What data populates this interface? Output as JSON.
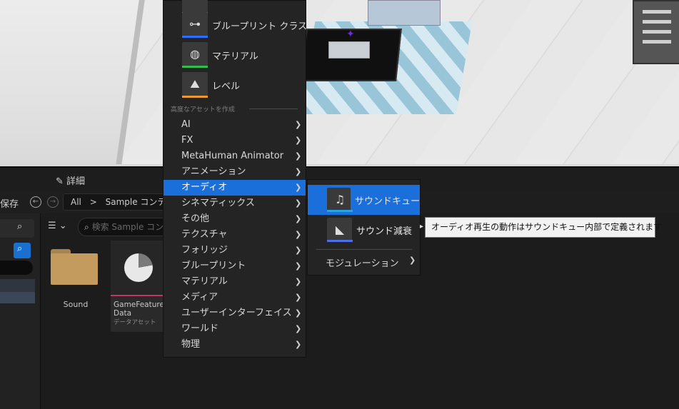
{
  "tabs": {
    "details": "詳細"
  },
  "toolbar": {
    "save": "保存",
    "back": "←",
    "forward": "→"
  },
  "breadcrumb": {
    "root": "All",
    "separator": ">",
    "current": "Sample コンテ"
  },
  "search": {
    "placeholder": "検索 Sample コン"
  },
  "assets": [
    {
      "name": "Sound",
      "type": ""
    },
    {
      "name": "GameFeature Data",
      "type": "データアセット"
    }
  ],
  "context_menu": {
    "basic_assets": [
      {
        "label": "ブループリント クラス",
        "icon": "blueprint-icon",
        "color": "#2f6fff"
      },
      {
        "label": "マテリアル",
        "icon": "material-icon",
        "color": "#2fbf4f"
      },
      {
        "label": "レベル",
        "icon": "level-icon",
        "color": "#e89a2c"
      }
    ],
    "section_title": "高度なアセットを作成",
    "items": [
      "AI",
      "FX",
      "MetaHuman Animator",
      "アニメーション",
      "オーディオ",
      "シネマティックス",
      "その他",
      "テクスチャ",
      "フォリッジ",
      "ブループリント",
      "マテリアル",
      "メディア",
      "ユーザーインターフェイス",
      "ワールド",
      "物理"
    ],
    "active_item": "オーディオ"
  },
  "audio_submenu": {
    "items": [
      {
        "label": "サウンドキュー",
        "icon": "sound-cue-icon",
        "color": "#2aa2e8"
      },
      {
        "label": "サウンド減衰",
        "icon": "sound-attenuation-icon",
        "color": "#4a6fe8"
      }
    ],
    "modulation": "モジュレーション"
  },
  "tooltip": "オーディオ再生の動作はサウンドキュー内部で定義されます",
  "colors": {
    "accent": "#1a6fdb",
    "menu_bg": "#242424",
    "asset_stripe": "#c8346a"
  }
}
